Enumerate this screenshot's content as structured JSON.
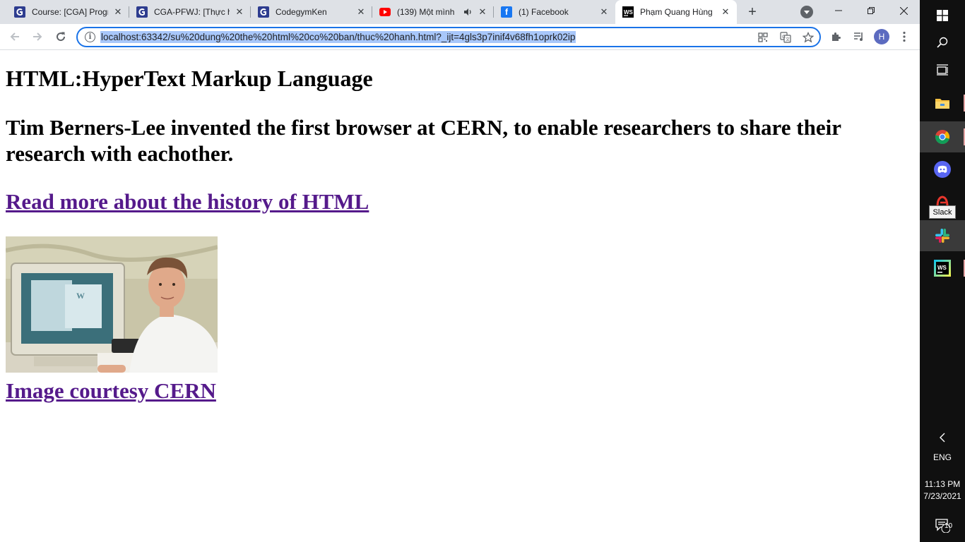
{
  "browser": {
    "tabs": [
      {
        "title": "Course: [CGA] Progra",
        "icon": "codegym-icon"
      },
      {
        "title": "CGA-PFWJ: [Thực hà",
        "icon": "codegym-icon"
      },
      {
        "title": "CodegymKen",
        "icon": "codegym-icon"
      },
      {
        "title": "(139) Một mình",
        "icon": "youtube-icon"
      },
      {
        "title": "(1) Facebook",
        "icon": "facebook-icon"
      },
      {
        "title": "Phạm Quang Hùng",
        "icon": "webstorm-icon"
      }
    ],
    "address": {
      "url": "localhost:63342/su%20dung%20the%20html%20co%20ban/thuc%20hanh.html?_ijt=4gls3p7inif4v68fh1oprk02ip"
    },
    "profile": {
      "initial": "H"
    }
  },
  "page": {
    "heading": "HTML:HyperText Markup Language",
    "subheading": "Tim Berners-Lee invented the first browser at CERN, to enable researchers to share their research with eachother.",
    "history_link": "Read more about the history of HTML",
    "image_alt": "Tim Berners-Lee at his NeXT computer",
    "credit_link": "Image courtesy CERN"
  },
  "taskbar": {
    "apps": [
      "file-explorer-icon",
      "chrome-icon",
      "discord-icon",
      "garena-icon",
      "slack-icon",
      "webstorm-icon"
    ],
    "tooltip": "Slack",
    "language": "ENG",
    "time": "11:13 PM",
    "date": "7/23/2021",
    "notifications": "10"
  },
  "colors": {
    "visited_link": "#551a8b",
    "omnibox_focus": "#1a73e8",
    "url_selection": "#a8c7fa",
    "tabstrip": "#dee1e6"
  }
}
